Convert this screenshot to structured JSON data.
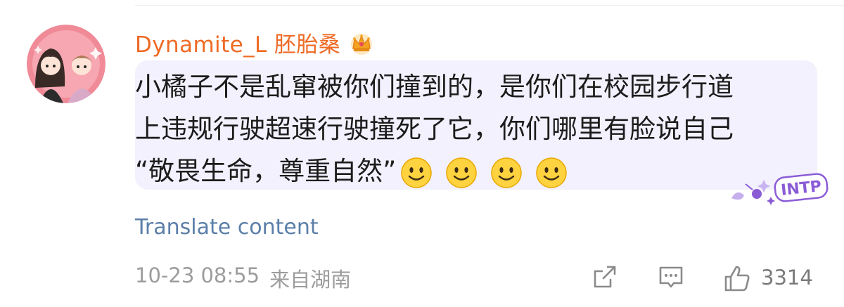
{
  "comment": {
    "username": "Dynamite_L 胚胎桑",
    "lines": [
      "小橘子不是乱窜被你们撞到的，是你们在校园步行道",
      "上违规行驶超速行驶撞死了它，你们哪里有脸说自己",
      "“敬畏生命，尊重自然”"
    ],
    "emoji_names": [
      "smile-emoji",
      "smile-emoji",
      "smile-emoji",
      "smile-emoji"
    ],
    "sticker_text": "INTP",
    "translate_label": "Translate content",
    "timestamp": "10-23 08:55",
    "location": "来自湖南",
    "like_count": "3314"
  },
  "colors": {
    "username": "#ef6a24",
    "bubble_bg": "#f3f1fd",
    "link": "#5b7fa8",
    "meta": "#9c9c9c",
    "avatar_bg": "#f08a97",
    "sticker": "#8b5cd6"
  },
  "icons": {
    "crown": "crown-icon",
    "share": "share-icon",
    "comment": "comment-icon",
    "like": "thumbs-up-icon"
  }
}
